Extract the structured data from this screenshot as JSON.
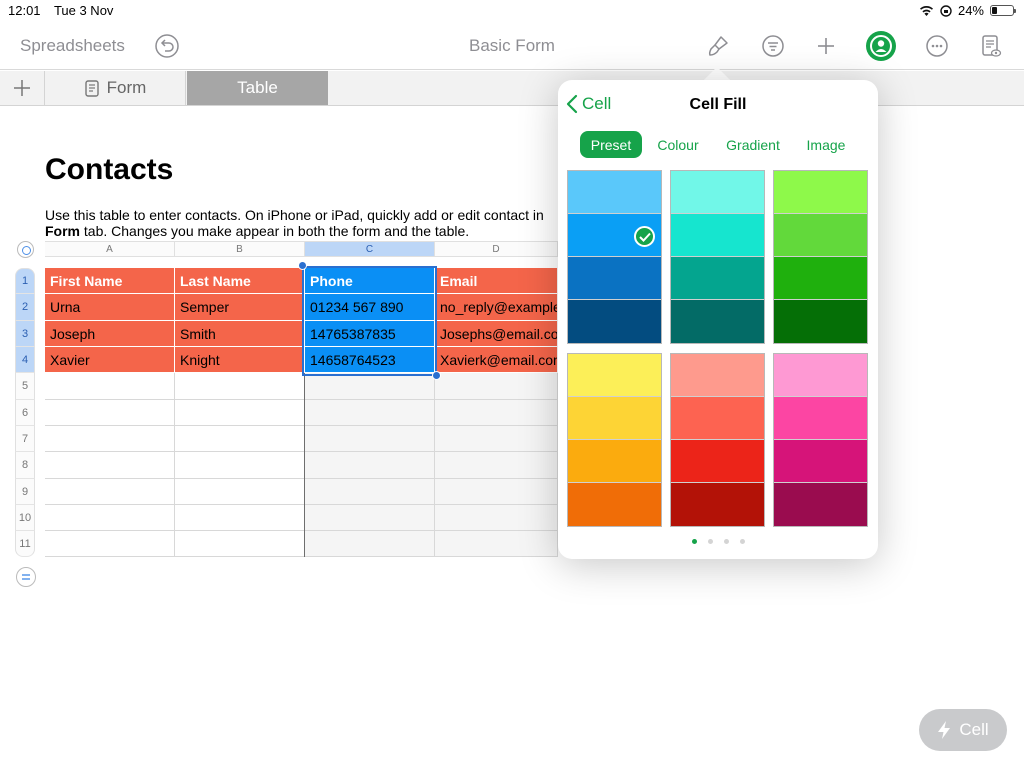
{
  "status_bar": {
    "time": "12:01",
    "date": "Tue 3 Nov",
    "battery": "24%",
    "battery_level": 0.24
  },
  "toolbar": {
    "back_label": "Spreadsheets",
    "doc_title": "Basic Form",
    "icons": [
      "undo-icon",
      "paintbrush-icon",
      "filter-icon",
      "add-icon",
      "collaborate-icon",
      "more-icon",
      "reader-view-icon"
    ],
    "accent_color": "#16a34a"
  },
  "sheet_tabs": {
    "tabs": [
      {
        "label": "Form"
      },
      {
        "label": "Table",
        "active": true
      }
    ]
  },
  "sheet": {
    "title": "Contacts",
    "desc_line1": "Use this table to enter contacts. On iPhone or iPad, quickly add or edit contact in",
    "desc_bold": "Form",
    "desc_line2": " tab. Changes you make appear in both the form and the table."
  },
  "table": {
    "columns": [
      "A",
      "B",
      "C",
      "D"
    ],
    "row_numbers": [
      "1",
      "2",
      "3",
      "4",
      "5",
      "6",
      "7",
      "8",
      "9",
      "10",
      "11"
    ],
    "header": [
      "First Name",
      "Last Name",
      "Phone",
      "Email"
    ],
    "rows": [
      [
        "Urna",
        "Semper",
        "01234 567 890",
        "no_reply@example.com"
      ],
      [
        "Joseph",
        "Smith",
        "14765387835",
        "Josephs@email.com"
      ],
      [
        "Xavier",
        "Knight",
        "14658764523",
        "Xavierk@email.com"
      ]
    ],
    "header_fill": "#f4654a",
    "selected_fill": "#0a8ff5",
    "selected_column": "C"
  },
  "popover": {
    "back_label": "Cell",
    "title": "Cell Fill",
    "segments": [
      "Preset",
      "Colour",
      "Gradient",
      "Image"
    ],
    "active_segment": "Preset",
    "swatch_groups": [
      [
        "#5ac8fa",
        "#0a9ff5",
        "#0a72c2",
        "#034c80"
      ],
      [
        "#71f7e8",
        "#16e5cf",
        "#04a58f",
        "#036b66"
      ],
      [
        "#8ef94a",
        "#62d93b",
        "#1fb00d",
        "#056f06"
      ],
      [
        "#fcef58",
        "#fdd435",
        "#fbab0e",
        "#f06d07"
      ],
      [
        "#fe9a8d",
        "#fd6351",
        "#ec2419",
        "#b31207"
      ],
      [
        "#fe99d3",
        "#fc45a3",
        "#d61479",
        "#9a0c4f"
      ]
    ],
    "selected_swatch": "#0a9ff5",
    "page_count": 4,
    "active_page": 0
  },
  "floating_button": {
    "label": "Cell"
  }
}
